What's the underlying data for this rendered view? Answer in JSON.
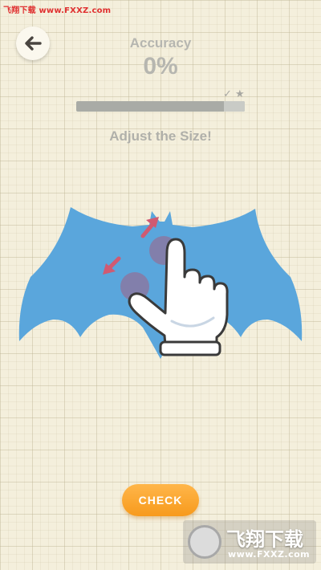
{
  "watermark": {
    "top_text": "飞翔下载 www.FXXZ.com",
    "bottom_title": "飞翔下载",
    "bottom_url": "www.FXXZ.com"
  },
  "header": {
    "accuracy_label": "Accuracy",
    "accuracy_value": "0%",
    "progress_percent": 0,
    "marks": "✓ ★"
  },
  "instruction": "Adjust the Size!",
  "check_button": {
    "label": "CHECK"
  },
  "colors": {
    "bat_shape": "#5aa6dc",
    "check_button": "#f9a329",
    "pinch_arrows": "#d05a72",
    "progress_track": "#a9aba6"
  },
  "icons": {
    "back": "arrow-left-icon",
    "hand": "pointing-hand-icon"
  }
}
